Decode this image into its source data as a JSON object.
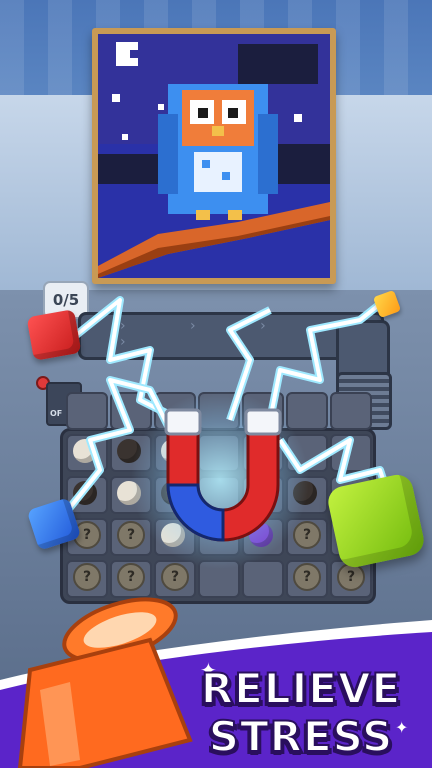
{
  "progress": {
    "label": "0/5"
  },
  "machine_panel": {
    "label": "OF"
  },
  "board": {
    "slots": [
      {
        "type": "empty"
      },
      {
        "type": "empty"
      },
      {
        "type": "empty"
      },
      {
        "type": "empty"
      },
      {
        "type": "empty"
      },
      {
        "type": "empty"
      },
      {
        "type": "empty"
      },
      {
        "type": "ball",
        "color": "#e8e2d6"
      },
      {
        "type": "ball",
        "color": "#3a3330"
      },
      {
        "type": "ball",
        "color": "#e8e2d6"
      },
      {
        "type": "empty"
      },
      {
        "type": "ball",
        "color": "#7b3fcf"
      },
      {
        "type": "empty"
      },
      {
        "type": "empty"
      },
      {
        "type": "ball",
        "color": "#3a3330"
      },
      {
        "type": "ball",
        "color": "#e8e2d6"
      },
      {
        "type": "ball",
        "color": "#3a3330"
      },
      {
        "type": "empty"
      },
      {
        "type": "ball",
        "color": "#3a3330"
      },
      {
        "type": "ball",
        "color": "#3a3330"
      },
      {
        "type": "empty"
      },
      {
        "type": "token",
        "label": "?"
      },
      {
        "type": "token",
        "label": "?"
      },
      {
        "type": "ball",
        "color": "#e8e2d6"
      },
      {
        "type": "empty"
      },
      {
        "type": "ball",
        "color": "#7b3fcf"
      },
      {
        "type": "token",
        "label": "?"
      },
      {
        "type": "empty"
      },
      {
        "type": "token",
        "label": "?"
      },
      {
        "type": "token",
        "label": "?"
      },
      {
        "type": "token",
        "label": "?"
      },
      {
        "type": "empty"
      },
      {
        "type": "empty"
      },
      {
        "type": "token",
        "label": "?"
      },
      {
        "type": "token",
        "label": "?"
      }
    ]
  },
  "banner": {
    "line1": "RELIEVE",
    "line2": "STRESS"
  },
  "colors": {
    "banner_purple": "#5b24c9",
    "jar_orange": "#ff6a1f",
    "magnet_red": "#e02b2b",
    "magnet_blue": "#2f5be0"
  },
  "icons": {
    "magnet": "magnet-icon",
    "jar": "jar-icon",
    "sparkle": "sparkle-icon"
  }
}
